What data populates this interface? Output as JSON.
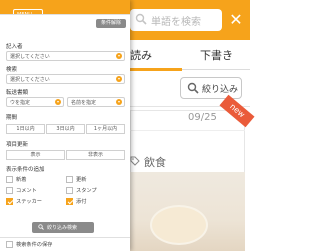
{
  "background": {
    "search_placeholder": "単語を検索",
    "close_symbol": "✕",
    "tabs": [
      "読み",
      "下書き"
    ],
    "filter_button_label": "絞り込み",
    "post": {
      "date": "09/25",
      "badge": "new",
      "category": "飲食"
    }
  },
  "panel": {
    "clear_label": "条件解除",
    "author": {
      "label": "記入者",
      "value": "選択してください"
    },
    "store": {
      "label": "検索",
      "value": "選択してください"
    },
    "sort": {
      "label": "転送書類",
      "values": [
        "ウを指定",
        "名前を指定"
      ]
    },
    "period": {
      "label": "期間",
      "options": [
        "1日以内",
        "3日以内",
        "1ヶ月以内"
      ]
    },
    "update": {
      "label": "項目更新",
      "options": [
        "表示",
        "非表示"
      ]
    },
    "display": {
      "label": "表示条件の追加",
      "options": [
        {
          "label": "新着",
          "checked": false
        },
        {
          "label": "更新",
          "checked": false
        },
        {
          "label": "コメント",
          "checked": false
        },
        {
          "label": "スタンプ",
          "checked": false
        },
        {
          "label": "ステッカー",
          "checked": true
        },
        {
          "label": "添付",
          "checked": true
        }
      ]
    },
    "search_button_label": "絞り込み検索",
    "save_condition_label": "検索条件の保存"
  },
  "colors": {
    "accent": "#f6a31b",
    "badge": "#ea5b3a",
    "button_gray": "#8a8a8a"
  }
}
